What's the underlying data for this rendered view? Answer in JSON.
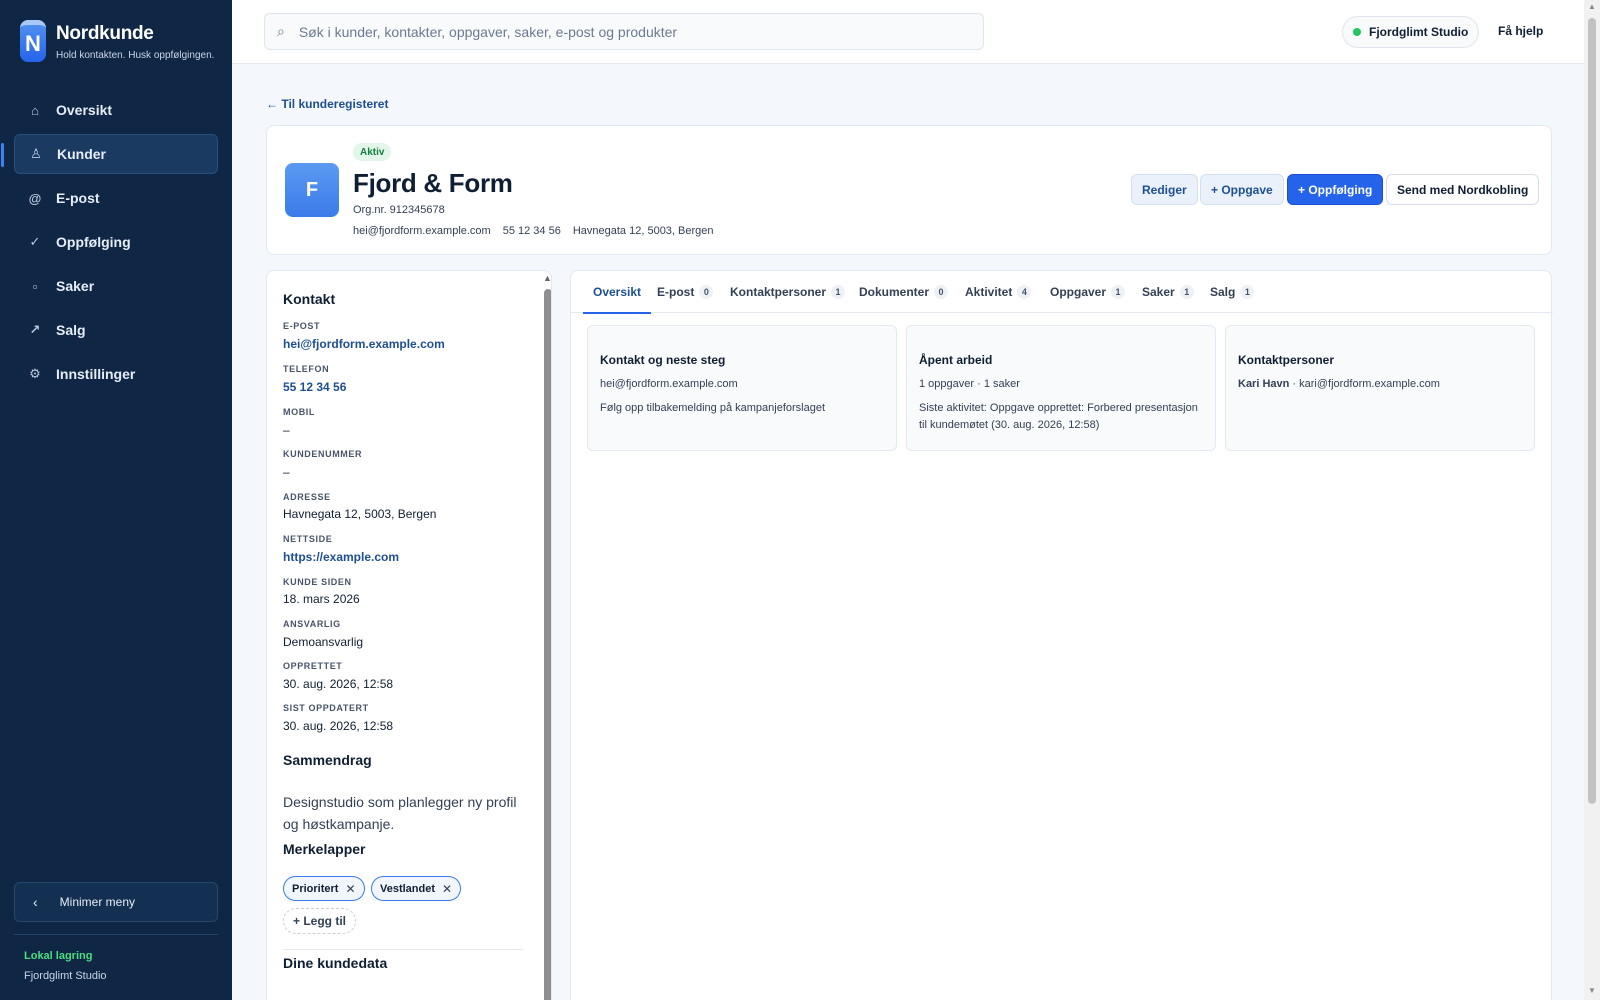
{
  "sidebar": {
    "brand_name": "Nordkunde",
    "brand_logo_letter": "N",
    "tagline": "Hold kontakten. Husk oppfølgingen.",
    "nav": [
      {
        "label": "Oversikt",
        "icon": "home-icon",
        "glyph": "⌂"
      },
      {
        "label": "Kunder",
        "icon": "person-icon",
        "glyph": "♙"
      },
      {
        "label": "E-post",
        "icon": "at-icon",
        "glyph": "@"
      },
      {
        "label": "Oppfølging",
        "icon": "check-icon",
        "glyph": "✓"
      },
      {
        "label": "Saker",
        "icon": "case-icon",
        "glyph": "▫"
      },
      {
        "label": "Salg",
        "icon": "trend-icon",
        "glyph": "↗"
      },
      {
        "label": "Innstillinger",
        "icon": "gear-icon",
        "glyph": "⚙"
      }
    ],
    "active_nav": "Kunder",
    "minimize_label": "Minimer meny",
    "storage_title": "Lokal lagring",
    "storage_org": "Fjordglimt Studio"
  },
  "topbar": {
    "search_placeholder": "Søk i kunder, kontakter, oppgaver, saker, e-post og produkter",
    "org_name": "Fjordglimt Studio",
    "help_label": "Få hjelp"
  },
  "customer": {
    "back_label": "← Til kunderegisteret",
    "avatar_letter": "F",
    "status": "Aktiv",
    "name": "Fjord & Form",
    "orgnr": "Org.nr. 912345678",
    "email": "hei@fjordform.example.com",
    "phone": "55 12 34 56",
    "address": "Havnegata 12, 5003, Bergen",
    "actions": {
      "edit": "Rediger",
      "task": "+ Oppgave",
      "followup": "+ Oppfølging",
      "send": "Send med Nordkobling"
    }
  },
  "contact_panel": {
    "title": "Kontakt",
    "fields": {
      "email_label": "E-POST",
      "email": "hei@fjordform.example.com",
      "phone_label": "TELEFON",
      "phone": "55 12 34 56",
      "mobile_label": "MOBIL",
      "mobile": "–",
      "customer_no_label": "KUNDENUMMER",
      "customer_no": "–",
      "address_label": "ADRESSE",
      "address": "Havnegata 12, 5003, Bergen",
      "website_label": "NETTSIDE",
      "website": "https://example.com",
      "since_label": "KUNDE SIDEN",
      "since": "18. mars 2026",
      "owner_label": "ANSVARLIG",
      "owner": "Demoansvarlig",
      "created_label": "OPPRETTET",
      "created": "30. aug. 2026, 12:58",
      "updated_label": "SIST OPPDATERT",
      "updated": "30. aug. 2026, 12:58"
    },
    "summary_title": "Sammendrag",
    "summary": "Designstudio som planlegger ny profil og høstkampanje.",
    "tags_title": "Merkelapper",
    "tags": [
      "Prioritert",
      "Vestlandet"
    ],
    "add_tag": "+ Legg til",
    "data_title": "Dine kundedata"
  },
  "tabs": [
    {
      "label": "Oversikt",
      "count": null
    },
    {
      "label": "E-post",
      "count": "0"
    },
    {
      "label": "Kontaktpersoner",
      "count": "1"
    },
    {
      "label": "Dokumenter",
      "count": "0"
    },
    {
      "label": "Aktivitet",
      "count": "4"
    },
    {
      "label": "Oppgaver",
      "count": "1"
    },
    {
      "label": "Saker",
      "count": "1"
    },
    {
      "label": "Salg",
      "count": "1"
    }
  ],
  "active_tab": "Oversikt",
  "overview": {
    "contact_card": {
      "title": "Kontakt og neste steg",
      "email": "hei@fjordform.example.com",
      "next_step": "Følg opp tilbakemelding på kampanjeforslaget"
    },
    "work_card": {
      "title": "Åpent arbeid",
      "counts": "1 oppgaver · 1 saker",
      "last_activity": "Siste aktivitet: Oppgave opprettet: Forbered presentasjon til kundemøtet (30. aug. 2026, 12:58)"
    },
    "people_card": {
      "title": "Kontaktpersoner",
      "person_name": "Kari Havn",
      "person_email": " · kari@fjordform.example.com"
    }
  },
  "colors": {
    "sidebar_bg": "#0f2744",
    "accent": "#2563eb",
    "status_green": "#15803d",
    "link": "#1d4f91"
  }
}
